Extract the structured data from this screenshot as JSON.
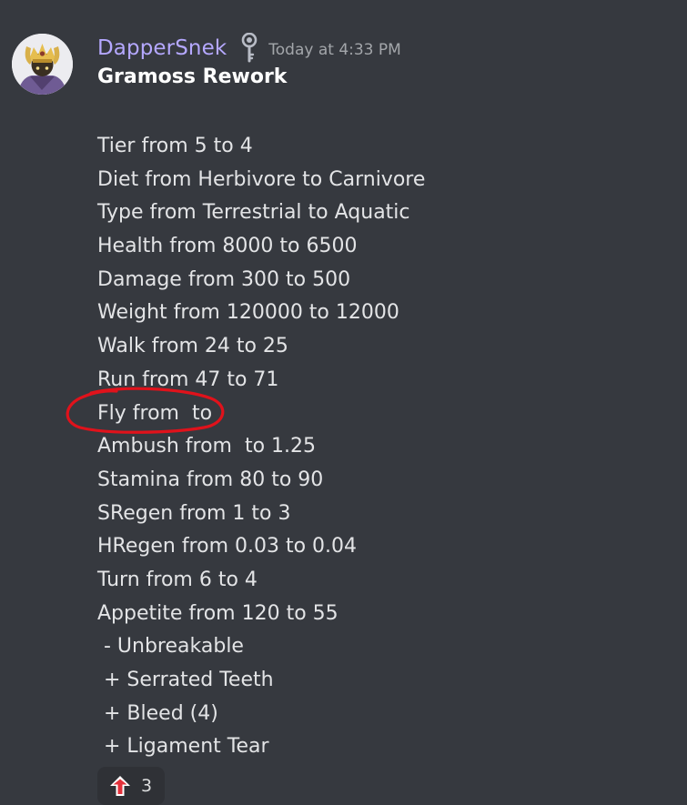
{
  "message": {
    "author": "DapperSnek",
    "timestamp": "Today at 4:33 PM",
    "role_icon": "key-icon",
    "title": "Gramoss Rework",
    "lines": [
      "Tier from 5 to 4",
      "Diet from Herbivore to Carnivore",
      "Type from Terrestrial to Aquatic",
      "Health from 8000 to 6500",
      "Damage from 300 to 500",
      "Weight from 120000 to 12000",
      "Walk from 24 to 25",
      "Run from 47 to 71",
      "Fly from  to",
      "Ambush from  to 1.25",
      "Stamina from 80 to 90",
      "SRegen from 1 to 3",
      "HRegen from 0.03 to 0.04",
      "Turn from 6 to 4",
      "Appetite from 120 to 55",
      " - Unbreakable",
      " + Serrated Teeth",
      " + Bleed (4)",
      " + Ligament Tear"
    ],
    "reaction": {
      "icon": "red-up-arrow-icon",
      "count": "3"
    }
  },
  "colors": {
    "background": "#36393f",
    "username": "#b5a8ff",
    "annotation_circle": "#e0121b"
  }
}
